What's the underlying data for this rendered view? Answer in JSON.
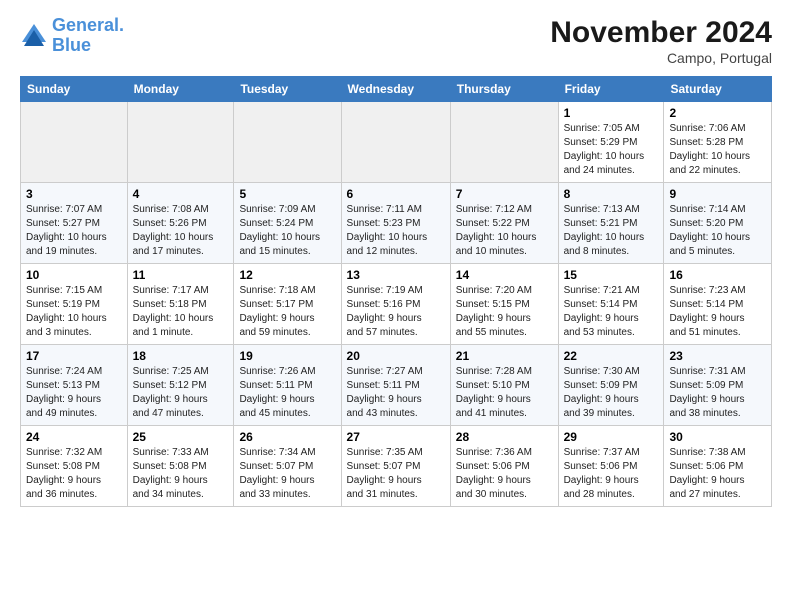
{
  "header": {
    "logo_line1": "General",
    "logo_line2": "Blue",
    "month_title": "November 2024",
    "location": "Campo, Portugal"
  },
  "weekdays": [
    "Sunday",
    "Monday",
    "Tuesday",
    "Wednesday",
    "Thursday",
    "Friday",
    "Saturday"
  ],
  "weeks": [
    [
      {
        "day": "",
        "info": ""
      },
      {
        "day": "",
        "info": ""
      },
      {
        "day": "",
        "info": ""
      },
      {
        "day": "",
        "info": ""
      },
      {
        "day": "",
        "info": ""
      },
      {
        "day": "1",
        "info": "Sunrise: 7:05 AM\nSunset: 5:29 PM\nDaylight: 10 hours\nand 24 minutes."
      },
      {
        "day": "2",
        "info": "Sunrise: 7:06 AM\nSunset: 5:28 PM\nDaylight: 10 hours\nand 22 minutes."
      }
    ],
    [
      {
        "day": "3",
        "info": "Sunrise: 7:07 AM\nSunset: 5:27 PM\nDaylight: 10 hours\nand 19 minutes."
      },
      {
        "day": "4",
        "info": "Sunrise: 7:08 AM\nSunset: 5:26 PM\nDaylight: 10 hours\nand 17 minutes."
      },
      {
        "day": "5",
        "info": "Sunrise: 7:09 AM\nSunset: 5:24 PM\nDaylight: 10 hours\nand 15 minutes."
      },
      {
        "day": "6",
        "info": "Sunrise: 7:11 AM\nSunset: 5:23 PM\nDaylight: 10 hours\nand 12 minutes."
      },
      {
        "day": "7",
        "info": "Sunrise: 7:12 AM\nSunset: 5:22 PM\nDaylight: 10 hours\nand 10 minutes."
      },
      {
        "day": "8",
        "info": "Sunrise: 7:13 AM\nSunset: 5:21 PM\nDaylight: 10 hours\nand 8 minutes."
      },
      {
        "day": "9",
        "info": "Sunrise: 7:14 AM\nSunset: 5:20 PM\nDaylight: 10 hours\nand 5 minutes."
      }
    ],
    [
      {
        "day": "10",
        "info": "Sunrise: 7:15 AM\nSunset: 5:19 PM\nDaylight: 10 hours\nand 3 minutes."
      },
      {
        "day": "11",
        "info": "Sunrise: 7:17 AM\nSunset: 5:18 PM\nDaylight: 10 hours\nand 1 minute."
      },
      {
        "day": "12",
        "info": "Sunrise: 7:18 AM\nSunset: 5:17 PM\nDaylight: 9 hours\nand 59 minutes."
      },
      {
        "day": "13",
        "info": "Sunrise: 7:19 AM\nSunset: 5:16 PM\nDaylight: 9 hours\nand 57 minutes."
      },
      {
        "day": "14",
        "info": "Sunrise: 7:20 AM\nSunset: 5:15 PM\nDaylight: 9 hours\nand 55 minutes."
      },
      {
        "day": "15",
        "info": "Sunrise: 7:21 AM\nSunset: 5:14 PM\nDaylight: 9 hours\nand 53 minutes."
      },
      {
        "day": "16",
        "info": "Sunrise: 7:23 AM\nSunset: 5:14 PM\nDaylight: 9 hours\nand 51 minutes."
      }
    ],
    [
      {
        "day": "17",
        "info": "Sunrise: 7:24 AM\nSunset: 5:13 PM\nDaylight: 9 hours\nand 49 minutes."
      },
      {
        "day": "18",
        "info": "Sunrise: 7:25 AM\nSunset: 5:12 PM\nDaylight: 9 hours\nand 47 minutes."
      },
      {
        "day": "19",
        "info": "Sunrise: 7:26 AM\nSunset: 5:11 PM\nDaylight: 9 hours\nand 45 minutes."
      },
      {
        "day": "20",
        "info": "Sunrise: 7:27 AM\nSunset: 5:11 PM\nDaylight: 9 hours\nand 43 minutes."
      },
      {
        "day": "21",
        "info": "Sunrise: 7:28 AM\nSunset: 5:10 PM\nDaylight: 9 hours\nand 41 minutes."
      },
      {
        "day": "22",
        "info": "Sunrise: 7:30 AM\nSunset: 5:09 PM\nDaylight: 9 hours\nand 39 minutes."
      },
      {
        "day": "23",
        "info": "Sunrise: 7:31 AM\nSunset: 5:09 PM\nDaylight: 9 hours\nand 38 minutes."
      }
    ],
    [
      {
        "day": "24",
        "info": "Sunrise: 7:32 AM\nSunset: 5:08 PM\nDaylight: 9 hours\nand 36 minutes."
      },
      {
        "day": "25",
        "info": "Sunrise: 7:33 AM\nSunset: 5:08 PM\nDaylight: 9 hours\nand 34 minutes."
      },
      {
        "day": "26",
        "info": "Sunrise: 7:34 AM\nSunset: 5:07 PM\nDaylight: 9 hours\nand 33 minutes."
      },
      {
        "day": "27",
        "info": "Sunrise: 7:35 AM\nSunset: 5:07 PM\nDaylight: 9 hours\nand 31 minutes."
      },
      {
        "day": "28",
        "info": "Sunrise: 7:36 AM\nSunset: 5:06 PM\nDaylight: 9 hours\nand 30 minutes."
      },
      {
        "day": "29",
        "info": "Sunrise: 7:37 AM\nSunset: 5:06 PM\nDaylight: 9 hours\nand 28 minutes."
      },
      {
        "day": "30",
        "info": "Sunrise: 7:38 AM\nSunset: 5:06 PM\nDaylight: 9 hours\nand 27 minutes."
      }
    ]
  ]
}
